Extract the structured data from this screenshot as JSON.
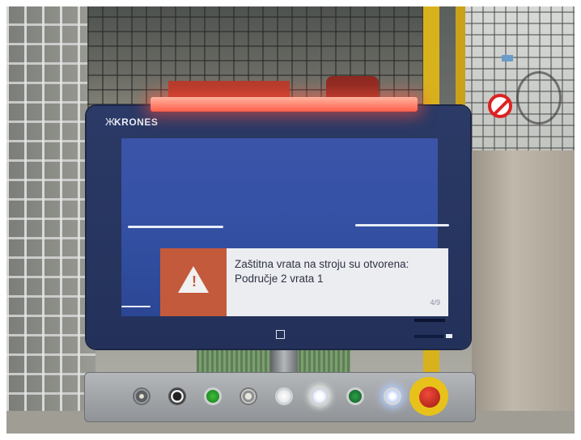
{
  "monitor": {
    "brand": "KRONES",
    "brand_mark": "Ж"
  },
  "alert": {
    "line1": "Zaštitna vrata na stroju su otvorena:",
    "line2": "Područje 2 vrata 1",
    "counter": "4/9",
    "icon": "warning-triangle-icon"
  },
  "colors": {
    "screen_blue": "#3552a6",
    "alert_accent": "#c45a3c",
    "bezel": "#23315a",
    "warning_light": "#ff5e4a"
  }
}
